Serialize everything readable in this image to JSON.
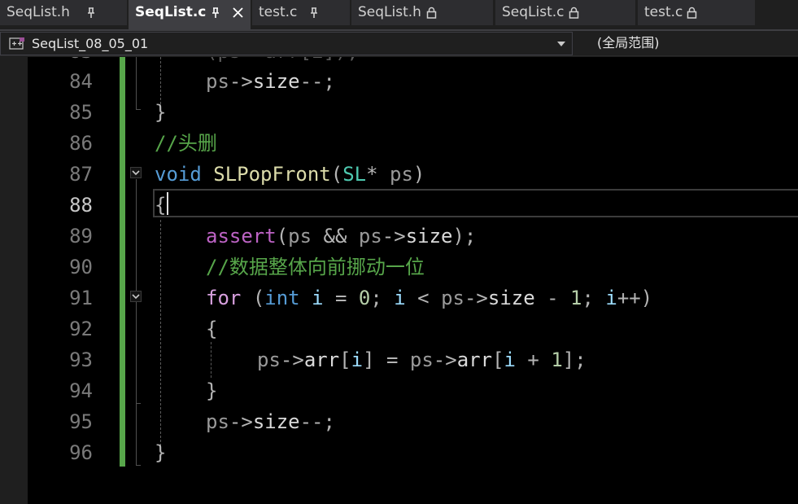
{
  "tabs": [
    {
      "label": "SeqList.h",
      "state": "pinned"
    },
    {
      "label": "SeqList.c",
      "state": "pinned-active"
    },
    {
      "label": "test.c",
      "state": "pinned"
    },
    {
      "label": "SeqList.h",
      "state": "locked"
    },
    {
      "label": "SeqList.c",
      "state": "locked"
    },
    {
      "label": "test.c",
      "state": "locked"
    }
  ],
  "navbar": {
    "project": "SeqList_08_05_01",
    "scope": "(全局范围)"
  },
  "editor": {
    "current_line": "88",
    "lines": [
      {
        "num": "84",
        "tokens": [
          "ps",
          "->",
          "size",
          "--",
          ";"
        ]
      },
      {
        "num": "85",
        "tokens": [
          "}"
        ]
      },
      {
        "num": "86",
        "tokens": [
          "//头删"
        ]
      },
      {
        "num": "87",
        "tokens": [
          "void",
          "SLPopFront",
          "(",
          "SL",
          "*",
          "ps",
          ")"
        ]
      },
      {
        "num": "88",
        "tokens": [
          "{"
        ]
      },
      {
        "num": "89",
        "tokens": [
          "assert",
          "(",
          "ps",
          "&&",
          "ps",
          "->",
          "size",
          ");"
        ]
      },
      {
        "num": "90",
        "tokens": [
          "//数据整体向前挪动一位"
        ]
      },
      {
        "num": "91",
        "tokens": [
          "for",
          "(",
          "int",
          "i",
          "=",
          "0",
          ";",
          "i",
          "<",
          "ps",
          "->",
          "size",
          "-",
          "1",
          ";",
          "i",
          "++",
          ")"
        ]
      },
      {
        "num": "92",
        "tokens": [
          "{"
        ]
      },
      {
        "num": "93",
        "tokens": [
          "ps",
          "->",
          "arr",
          "[",
          "i",
          "]",
          "=",
          "ps",
          "->",
          "arr",
          "[",
          "i",
          "+",
          "1",
          "];"
        ]
      },
      {
        "num": "94",
        "tokens": [
          "}"
        ]
      },
      {
        "num": "95",
        "tokens": [
          "ps",
          "->",
          "size",
          "--",
          ";"
        ]
      },
      {
        "num": "96",
        "tokens": [
          "}"
        ]
      }
    ]
  },
  "colors": {
    "keyword": "#569cd6",
    "flow_keyword": "#d8a0df",
    "function": "#dcdcaa",
    "type": "#4ec9b0",
    "parameter": "#9a9a9a",
    "macro": "#bd63c5",
    "number": "#b5cea8",
    "comment": "#57a64a",
    "change_bar": "#57a64a"
  },
  "icons": {
    "pin": "pin-icon",
    "lock": "lock-icon",
    "close": "close-icon",
    "project": "cpp-project-icon",
    "dropdown": "chevron-down-icon",
    "fold": "fold-collapse-icon"
  }
}
